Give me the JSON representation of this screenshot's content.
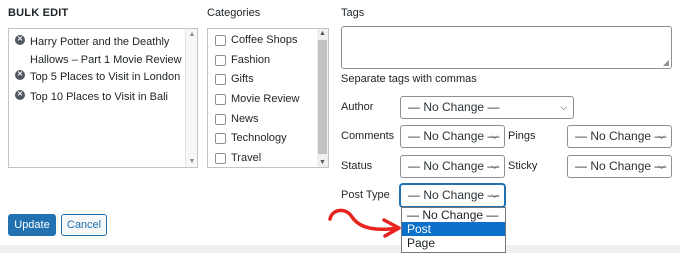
{
  "bulk_edit": {
    "heading": "BULK EDIT",
    "posts": [
      {
        "title": "Harry Potter and the Deathly Hallows – Part 1 Movie Review"
      },
      {
        "title": "Top 5 Places to Visit in London"
      },
      {
        "title": "Top 10 Places to Visit in Bali"
      }
    ]
  },
  "categories": {
    "heading": "Categories",
    "items": [
      {
        "label": "Coffee Shops",
        "checked": false
      },
      {
        "label": "Fashion",
        "checked": false
      },
      {
        "label": "Gifts",
        "checked": false
      },
      {
        "label": "Movie Review",
        "checked": false
      },
      {
        "label": "News",
        "checked": false
      },
      {
        "label": "Technology",
        "checked": false
      },
      {
        "label": "Travel",
        "checked": false
      }
    ]
  },
  "tags": {
    "heading": "Tags",
    "value": "",
    "hint": "Separate tags with commas"
  },
  "fields": {
    "author": {
      "label": "Author",
      "value": "— No Change —"
    },
    "comments": {
      "label": "Comments",
      "value": "— No Change —"
    },
    "pings": {
      "label": "Pings",
      "value": "— No Change —"
    },
    "status": {
      "label": "Status",
      "value": "— No Change —"
    },
    "sticky": {
      "label": "Sticky",
      "value": "— No Change —"
    },
    "post_type": {
      "label": "Post Type",
      "value": "— No Change —"
    }
  },
  "post_type_dropdown": {
    "options": [
      "— No Change —",
      "Post",
      "Page"
    ],
    "highlighted_index": 1
  },
  "buttons": {
    "update": "Update",
    "cancel": "Cancel"
  },
  "colors": {
    "primary": "#2271b1",
    "highlight": "#0a70c9",
    "annotation_arrow": "#e8231f"
  },
  "icons": {
    "remove": "x-circle-icon",
    "chevron": "chevron-down-icon",
    "annotation": "red-curved-arrow-icon"
  }
}
